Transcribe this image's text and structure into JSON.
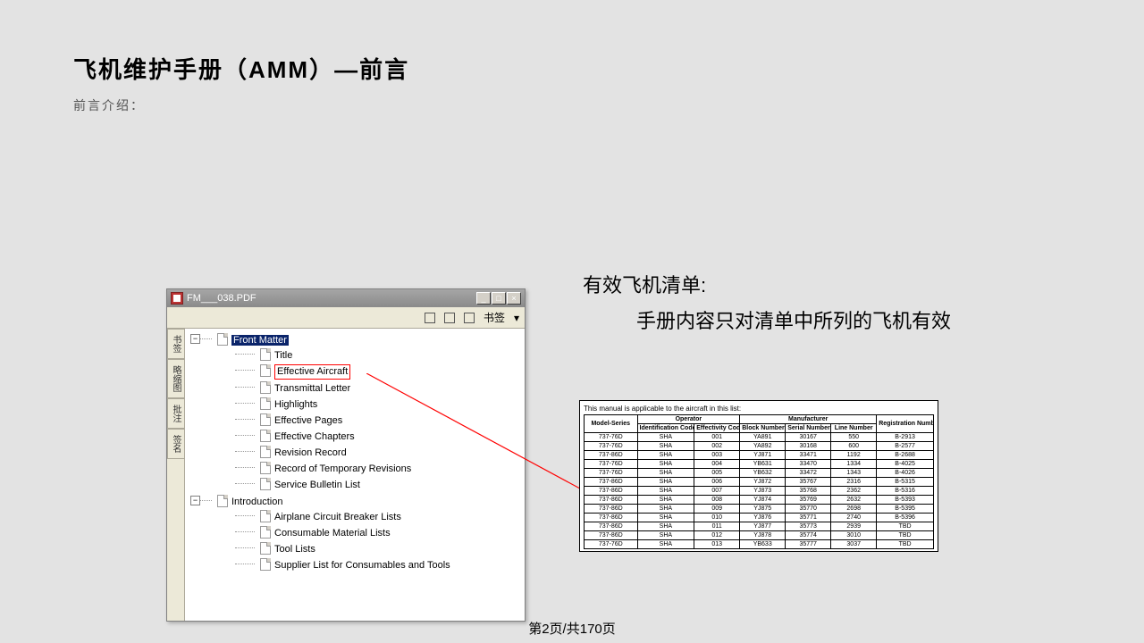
{
  "slide": {
    "title": "飞机维护手册（AMM）—前言",
    "subtitle": "前言介绍：",
    "footer": "第2页/共170页"
  },
  "right": {
    "heading": "有效飞机清单:",
    "body_indent_label": "",
    "body": "手册内容只对清单中所列的飞机有效"
  },
  "pdfwin": {
    "title": "FM___038.PDF",
    "min_label": "_",
    "max_label": "□",
    "close_label": "×",
    "bookmark_label": "书签",
    "dropdown_glyph": "▾",
    "sidetabs": [
      "书签",
      "略缩图",
      "批注",
      "签名"
    ],
    "tree": {
      "root": {
        "label": "Front Matter",
        "expander": "−",
        "children": [
          {
            "label": "Title"
          },
          {
            "label": "Effective Aircraft",
            "highlight": true
          },
          {
            "label": "Transmittal Letter"
          },
          {
            "label": "Highlights"
          },
          {
            "label": "Effective Pages"
          },
          {
            "label": "Effective Chapters"
          },
          {
            "label": "Revision Record"
          },
          {
            "label": "Record of Temporary Revisions"
          },
          {
            "label": "Service Bulletin List"
          }
        ]
      },
      "intro": {
        "label": "Introduction",
        "expander": "−",
        "children": [
          {
            "label": "Airplane Circuit Breaker Lists"
          },
          {
            "label": "Consumable Material Lists"
          },
          {
            "label": "Tool Lists"
          },
          {
            "label": "Supplier List for Consumables and Tools"
          }
        ]
      }
    }
  },
  "table": {
    "caption": "This manual is applicable to the aircraft in this list:",
    "group_operator": "Operator",
    "group_manufacturer": "Manufacturer",
    "headers": {
      "model": "Model-Series",
      "idcode": "Identification Code",
      "effcode": "Effectivity Code",
      "block": "Block Number",
      "serial": "Serial Number",
      "line": "Line Number",
      "reg": "Registration Number"
    },
    "rows": [
      {
        "model": "737-76D",
        "idcode": "SHA",
        "effcode": "001",
        "block": "YA891",
        "serial": "30167",
        "line": "550",
        "reg": "B-2913"
      },
      {
        "model": "737-76D",
        "idcode": "SHA",
        "effcode": "002",
        "block": "YA892",
        "serial": "30168",
        "line": "600",
        "reg": "B-2577"
      },
      {
        "model": "737-86D",
        "idcode": "SHA",
        "effcode": "003",
        "block": "YJ871",
        "serial": "33471",
        "line": "1192",
        "reg": "B-2688"
      },
      {
        "model": "737-76D",
        "idcode": "SHA",
        "effcode": "004",
        "block": "YB631",
        "serial": "33470",
        "line": "1334",
        "reg": "B-4025"
      },
      {
        "model": "737-76D",
        "idcode": "SHA",
        "effcode": "005",
        "block": "YB632",
        "serial": "33472",
        "line": "1343",
        "reg": "B-4026"
      },
      {
        "model": "737-86D",
        "idcode": "SHA",
        "effcode": "006",
        "block": "YJ872",
        "serial": "35767",
        "line": "2316",
        "reg": "B-5315"
      },
      {
        "model": "737-86D",
        "idcode": "SHA",
        "effcode": "007",
        "block": "YJ873",
        "serial": "35768",
        "line": "2362",
        "reg": "B-5316"
      },
      {
        "model": "737-86D",
        "idcode": "SHA",
        "effcode": "008",
        "block": "YJ874",
        "serial": "35769",
        "line": "2632",
        "reg": "B-5393"
      },
      {
        "model": "737-86D",
        "idcode": "SHA",
        "effcode": "009",
        "block": "YJ875",
        "serial": "35770",
        "line": "2698",
        "reg": "B-5395"
      },
      {
        "model": "737-86D",
        "idcode": "SHA",
        "effcode": "010",
        "block": "YJ876",
        "serial": "35771",
        "line": "2740",
        "reg": "B-5396"
      },
      {
        "model": "737-86D",
        "idcode": "SHA",
        "effcode": "011",
        "block": "YJ877",
        "serial": "35773",
        "line": "2939",
        "reg": "TBD"
      },
      {
        "model": "737-86D",
        "idcode": "SHA",
        "effcode": "012",
        "block": "YJ878",
        "serial": "35774",
        "line": "3010",
        "reg": "TBD"
      },
      {
        "model": "737-76D",
        "idcode": "SHA",
        "effcode": "013",
        "block": "YB633",
        "serial": "35777",
        "line": "3037",
        "reg": "TBD"
      }
    ]
  }
}
